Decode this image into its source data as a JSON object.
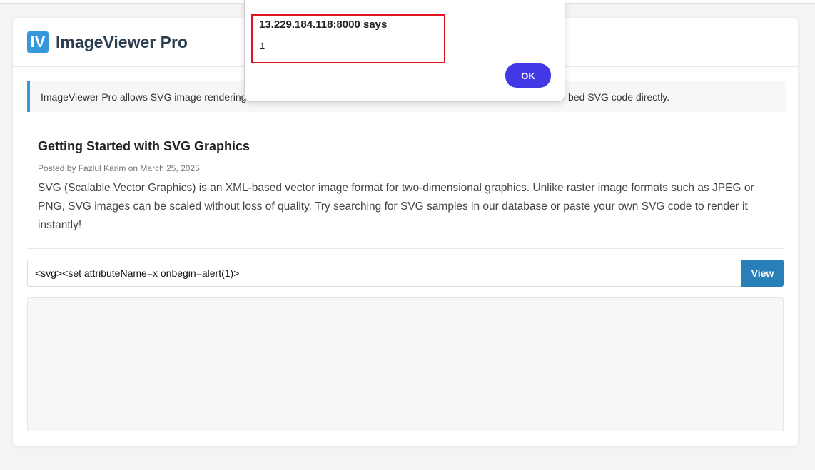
{
  "app": {
    "logo": "IV",
    "title": "ImageViewer Pro"
  },
  "info": {
    "text_left": "ImageViewer Pro allows SVG image rendering",
    "text_right": "bed SVG code directly."
  },
  "post": {
    "title": "Getting Started with SVG Graphics",
    "meta": "Posted by Fazlul Karim on March 25, 2025",
    "body": "SVG (Scalable Vector Graphics) is an XML-based vector image format for two-dimensional graphics. Unlike raster image formats such as JPEG or PNG, SVG images can be scaled without loss of quality. Try searching for SVG samples in our database or paste your own SVG code to render it instantly!"
  },
  "viewer": {
    "input_value": "<svg><set attributeName=x onbegin=alert(1)>",
    "button": "View"
  },
  "alert": {
    "title": "13.229.184.118:8000 says",
    "message": "1",
    "ok": "OK"
  }
}
